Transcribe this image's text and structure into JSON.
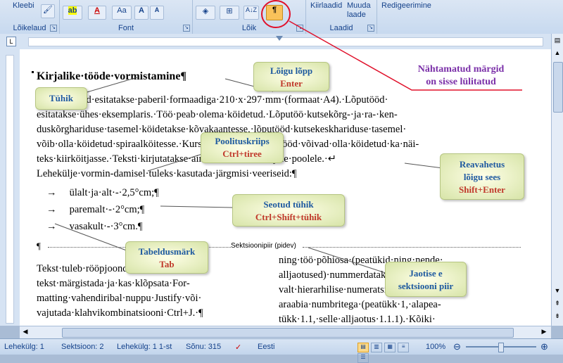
{
  "ribbon": {
    "clipboard": {
      "paste_label": "Kleebi",
      "group": "Lõikelaud"
    },
    "font": {
      "group": "Font",
      "aa_label": "Aa",
      "grow": "A",
      "shrink": "A"
    },
    "paragraph": {
      "group": "Lõik",
      "sort_label": "A↓Z"
    },
    "styles": {
      "group": "Laadid",
      "quick_label": "Kiirlaadid",
      "change_label": "Muuda laade"
    },
    "editing": {
      "group": "Redigeerimine",
      "label": "Redigeerimine"
    },
    "pilcrow": "¶"
  },
  "document": {
    "title": "Kirjalike·tööde·vormistamine¶",
    "lines": [
      "           d·tööd·esitatakse·paberil·formaadiga·210·x·297·mm·(formaat·A4).·Lõputööd·",
      "esitatakse·ühes·eksemplaris.·Töö·peab·olema·köidetud.·Lõputöö·kutsekõrg-·ja·ra-·ken-",
      "duskõrghariduse·tasemel·köidetakse·kõvakaantesse,·lõputööd·kutsekeskhariduse·tasemel·",
      "võib·olla·köidetud·spiraalköitesse.·Kursuse-·jm·kirjalikud·tööd·võivad·olla·köidetud·ka·näi-",
      "teks·kiirköitjasse.·Teksti·kirjutatakse·ainult·ühele·leheküljele·poolele.·↵",
      "Lehekülje·vormin-damisel·tuleks·kasutada·järgmisi·veeriseid:¶"
    ],
    "list": [
      "ülalt·ja·alt·-·2,5°cm;¶",
      "paremalt·-·2°cm;¶",
      "vasakult·-·3°cm.¶"
    ],
    "section_break": "Sektsioonipiir (pidev)",
    "section_pilcrow": "¶",
    "col_left": [
      "Tekst·tuleb·rööpjoondada,·st·tuleb·",
      "tekst·märgistada·ja·kas·klõpsata·For-",
      "matting·vahendiribal·nuppu·Justify·või·",
      "vajutada·klahvikombinatsiooni·Ctrl+J.·¶"
    ],
    "col_right": [
      "ning·töö·põhiosa·(peatükid·ning·nende·",
      "alljaotused)·nummerdatakse·",
      "valt·hierarhilise·numeratsiooniga·",
      "araabia·numbritega·(peatükk·1,·alapea-",
      "tükk·1.1,·selle·alljaotus·1.1.1).·Kõiki·"
    ]
  },
  "callouts": {
    "paragraph_end": {
      "line1": "Lõigu lõpp",
      "line2": "Enter"
    },
    "space": {
      "line1": "Tühik"
    },
    "soft_hyphen": {
      "line1": "Poolituskriips",
      "line2": "Ctrl+tiree"
    },
    "line_break": {
      "line1": "Reavahetus",
      "line2": "lõigu sees",
      "line3": "Shift+Enter"
    },
    "nbsp": {
      "line1": "Seotud tühik",
      "line2": "Ctrl+Shift+tühik"
    },
    "tab": {
      "line1": "Tabeldusmärk",
      "line2": "Tab"
    },
    "section": {
      "line1": "Jaotise e",
      "line2": "sektsiooni piir"
    }
  },
  "annotation": {
    "line1": "Nähtamatud märgid",
    "line2": "on sisse lülitatud"
  },
  "status": {
    "page": "Lehekülg: 1",
    "section": "Sektsioon: 2",
    "page_of": "Lehekülg: 1 1-st",
    "words": "Sõnu: 315",
    "language": "Eesti",
    "zoom": "100%"
  },
  "colors": {
    "annotation": "#7a2fa8",
    "annotation_line": "#e0102a",
    "callout_title": "#1f5aa0",
    "callout_key": "#c0392b"
  }
}
